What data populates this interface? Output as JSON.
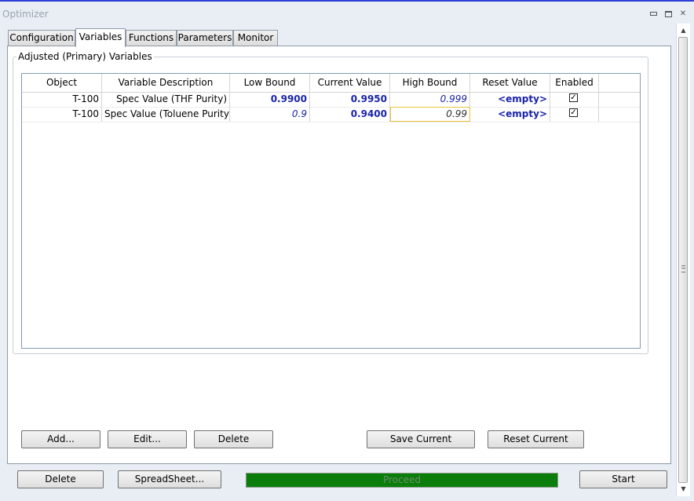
{
  "window": {
    "title": "Optimizer"
  },
  "tabs": [
    {
      "label": "Configuration"
    },
    {
      "label": "Variables"
    },
    {
      "label": "Functions"
    },
    {
      "label": "Parameters"
    },
    {
      "label": "Monitor"
    }
  ],
  "active_tab": "Variables",
  "group": {
    "title": "Adjusted (Primary) Variables"
  },
  "grid": {
    "headers": [
      "Object",
      "Variable Description",
      "Low Bound",
      "Current Value",
      "High Bound",
      "Reset Value",
      "Enabled"
    ],
    "rows": [
      {
        "object": "T-100",
        "description": "Spec Value (THF Purity)",
        "low": "0.9900",
        "current": "0.9950",
        "high": "0.999",
        "reset": "<empty>",
        "enabled": true
      },
      {
        "object": "T-100",
        "description": "Spec Value (Toluene Purity)",
        "low": "0.9",
        "current": "0.9400",
        "high": "0.99",
        "reset": "<empty>",
        "enabled": true
      }
    ]
  },
  "actions": {
    "add": "Add...",
    "edit": "Edit...",
    "delete": "Delete",
    "save_current": "Save Current",
    "reset_current": "Reset Current"
  },
  "footer": {
    "delete": "Delete",
    "spreadsheet": "SpreadSheet...",
    "status": "Proceed",
    "start": "Start"
  },
  "colors": {
    "accent_blue": "#1b24a8",
    "status_green": "#0a7d0a",
    "title_border": "#2b3ed6"
  }
}
